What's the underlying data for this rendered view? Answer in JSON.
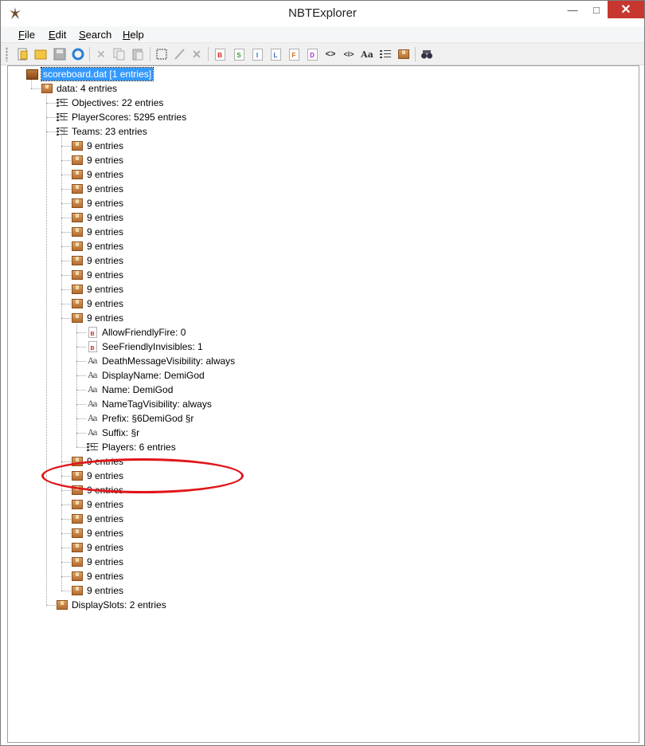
{
  "window": {
    "title": "NBTExplorer"
  },
  "menu": [
    {
      "label": "File",
      "hot": "F",
      "rest": "ile"
    },
    {
      "label": "Edit",
      "hot": "E",
      "rest": "dit"
    },
    {
      "label": "Search",
      "hot": "S",
      "rest": "earch"
    },
    {
      "label": "Help",
      "hot": "H",
      "rest": "elp"
    }
  ],
  "toolbar": {
    "icons": [
      "open-file-icon",
      "open-folder-icon",
      "save-icon",
      "refresh-icon",
      "cut-icon",
      "copy-icon",
      "paste-icon",
      "rename-icon",
      "edit-icon",
      "delete-icon",
      "add-byte-icon",
      "add-short-icon",
      "add-int-icon",
      "add-long-icon",
      "add-float-icon",
      "add-double-icon",
      "add-byte-array-icon",
      "add-int-array-icon",
      "add-string-icon",
      "add-list-icon",
      "add-compound-icon",
      "find-icon"
    ],
    "tag_letters": {
      "byte": "B",
      "short": "S",
      "int": "I",
      "long": "L",
      "float": "F",
      "double": "D"
    },
    "text_glyphs": {
      "array": "<>",
      "int_array": "<i>",
      "string": "Aa"
    }
  },
  "tree": [
    {
      "depth": 0,
      "icon": "dat",
      "exp": "-",
      "text": "scoreboard.dat [1 entries]",
      "selected": true
    },
    {
      "depth": 1,
      "icon": "box",
      "exp": "-",
      "text": "data: 4 entries"
    },
    {
      "depth": 2,
      "icon": "list",
      "exp": "+",
      "text": "Objectives: 22 entries"
    },
    {
      "depth": 2,
      "icon": "list",
      "exp": "+",
      "text": "PlayerScores: 5295 entries"
    },
    {
      "depth": 2,
      "icon": "list",
      "exp": "-",
      "text": "Teams: 23 entries"
    },
    {
      "depth": 3,
      "icon": "box",
      "exp": "+",
      "text": "9 entries"
    },
    {
      "depth": 3,
      "icon": "box",
      "exp": "+",
      "text": "9 entries"
    },
    {
      "depth": 3,
      "icon": "box",
      "exp": "+",
      "text": "9 entries"
    },
    {
      "depth": 3,
      "icon": "box",
      "exp": "+",
      "text": "9 entries"
    },
    {
      "depth": 3,
      "icon": "box",
      "exp": "+",
      "text": "9 entries"
    },
    {
      "depth": 3,
      "icon": "box",
      "exp": "+",
      "text": "9 entries"
    },
    {
      "depth": 3,
      "icon": "box",
      "exp": "+",
      "text": "9 entries"
    },
    {
      "depth": 3,
      "icon": "box",
      "exp": "+",
      "text": "9 entries"
    },
    {
      "depth": 3,
      "icon": "box",
      "exp": "+",
      "text": "9 entries"
    },
    {
      "depth": 3,
      "icon": "box",
      "exp": "+",
      "text": "9 entries"
    },
    {
      "depth": 3,
      "icon": "box",
      "exp": "+",
      "text": "9 entries"
    },
    {
      "depth": 3,
      "icon": "box",
      "exp": "+",
      "text": "9 entries"
    },
    {
      "depth": 3,
      "icon": "box",
      "exp": "-",
      "text": "9 entries"
    },
    {
      "depth": 4,
      "icon": "byte",
      "exp": "",
      "text": "AllowFriendlyFire: 0"
    },
    {
      "depth": 4,
      "icon": "byte",
      "exp": "",
      "text": "SeeFriendlyInvisibles: 1"
    },
    {
      "depth": 4,
      "icon": "str",
      "exp": "",
      "text": "DeathMessageVisibility: always"
    },
    {
      "depth": 4,
      "icon": "str",
      "exp": "",
      "text": "DisplayName: DemiGod"
    },
    {
      "depth": 4,
      "icon": "str",
      "exp": "",
      "text": "Name: DemiGod"
    },
    {
      "depth": 4,
      "icon": "str",
      "exp": "",
      "text": "NameTagVisibility: always"
    },
    {
      "depth": 4,
      "icon": "str",
      "exp": "",
      "text": "Prefix: §6DemiGod §r"
    },
    {
      "depth": 4,
      "icon": "str",
      "exp": "",
      "text": "Suffix: §r"
    },
    {
      "depth": 4,
      "icon": "list",
      "exp": "+",
      "text": "Players: 6 entries"
    },
    {
      "depth": 3,
      "icon": "box",
      "exp": "+",
      "text": "9 entries"
    },
    {
      "depth": 3,
      "icon": "box",
      "exp": "+",
      "text": "9 entries"
    },
    {
      "depth": 3,
      "icon": "box",
      "exp": "+",
      "text": "9 entries"
    },
    {
      "depth": 3,
      "icon": "box",
      "exp": "+",
      "text": "9 entries"
    },
    {
      "depth": 3,
      "icon": "box",
      "exp": "+",
      "text": "9 entries"
    },
    {
      "depth": 3,
      "icon": "box",
      "exp": "+",
      "text": "9 entries"
    },
    {
      "depth": 3,
      "icon": "box",
      "exp": "+",
      "text": "9 entries"
    },
    {
      "depth": 3,
      "icon": "box",
      "exp": "+",
      "text": "9 entries"
    },
    {
      "depth": 3,
      "icon": "box",
      "exp": "+",
      "text": "9 entries"
    },
    {
      "depth": 3,
      "icon": "box",
      "exp": "+",
      "text": "9 entries"
    },
    {
      "depth": 2,
      "icon": "box",
      "exp": "+",
      "text": "DisplaySlots: 2 entries"
    }
  ],
  "colors": {
    "selection": "#3399ff",
    "annotation": "#e0161b",
    "close_button": "#c7372f"
  }
}
